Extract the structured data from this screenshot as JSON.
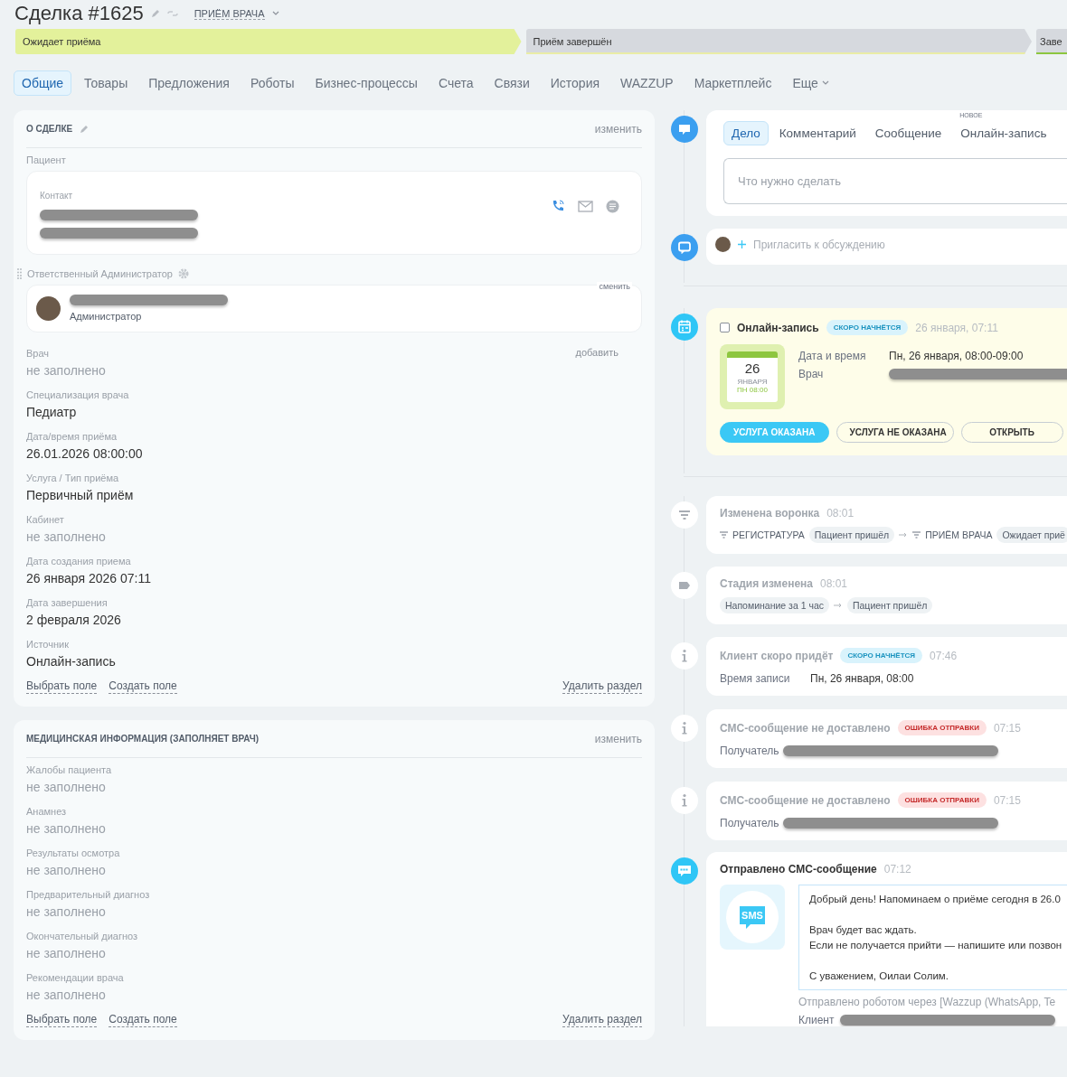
{
  "deal": {
    "title": "Сделка #1625",
    "pipeline": "ПРИЁМ ВРАЧА"
  },
  "stages": [
    {
      "label": "Ожидает приёма",
      "selected": true,
      "color": "#e3f19b"
    },
    {
      "label": "Приём завершён",
      "selected": false,
      "color": "#e9eca6"
    },
    {
      "label": "Заве",
      "selected": false,
      "color": "#8dc63f"
    }
  ],
  "tabs": [
    {
      "label": "Общие",
      "selected": true,
      "kind": "tab"
    },
    {
      "label": "Товары",
      "selected": false,
      "kind": "tab"
    },
    {
      "label": "Предложения",
      "selected": false,
      "kind": "tab"
    },
    {
      "label": "Роботы",
      "selected": false,
      "kind": "tab"
    },
    {
      "label": "Бизнес-процессы",
      "selected": false,
      "kind": "tab"
    },
    {
      "label": "Счета",
      "selected": false,
      "kind": "tab"
    },
    {
      "label": "Связи",
      "selected": false,
      "kind": "tab"
    },
    {
      "label": "История",
      "selected": false,
      "kind": "tab"
    },
    {
      "label": "WAZZUP",
      "selected": false,
      "kind": "tab"
    },
    {
      "label": "Маркетплейс",
      "selected": false,
      "kind": "tab"
    },
    {
      "label": "Еще",
      "selected": false,
      "kind": "more"
    }
  ],
  "sections": [
    {
      "title": "О СДЕЛКЕ",
      "renamable": true,
      "action": "изменить",
      "fields": [
        {
          "kind": "contact",
          "label": "Пациент",
          "sublabel": "Контакт"
        },
        {
          "kind": "user",
          "label": "Ответственный Администратор",
          "action": "сменить",
          "role": "Администратор"
        },
        {
          "kind": "text",
          "label": "Врач",
          "value": "не заполнено",
          "empty": true,
          "action": "добавить"
        },
        {
          "kind": "text",
          "label": "Специализация врача",
          "value": "Педиатр",
          "empty": false
        },
        {
          "kind": "text",
          "label": "Дата/время приёма",
          "value": "26.01.2026 08:00:00",
          "empty": false
        },
        {
          "kind": "text",
          "label": "Услуга / Тип приёма",
          "value": "Первичный приём",
          "empty": false
        },
        {
          "kind": "text",
          "label": "Кабинет",
          "value": "не заполнено",
          "empty": true
        },
        {
          "kind": "text",
          "label": "Дата создания приема",
          "value": "26 января 2026 07:11",
          "empty": false
        },
        {
          "kind": "text",
          "label": "Дата завершения",
          "value": "2 февраля 2026",
          "empty": false
        },
        {
          "kind": "text",
          "label": "Источник",
          "value": "Онлайн-запись",
          "empty": false
        }
      ],
      "links": [
        "Выбрать поле",
        "Создать поле"
      ],
      "delete_label": "Удалить раздел"
    },
    {
      "title": "МЕДИЦИНСКАЯ ИНФОРМАЦИЯ (ЗАПОЛНЯЕТ ВРАЧ)",
      "renamable": false,
      "action": "изменить",
      "fields": [
        {
          "kind": "text",
          "label": "Жалобы пациента",
          "value": "не заполнено",
          "empty": true
        },
        {
          "kind": "text",
          "label": "Анамнез",
          "value": "не заполнено",
          "empty": true
        },
        {
          "kind": "text",
          "label": "Результаты осмотра",
          "value": "не заполнено",
          "empty": true
        },
        {
          "kind": "text",
          "label": "Предварительный диагноз",
          "value": "не заполнено",
          "empty": true
        },
        {
          "kind": "text",
          "label": "Окончательный диагноз",
          "value": "не заполнено",
          "empty": true
        },
        {
          "kind": "text",
          "label": "Рекомендации врача",
          "value": "не заполнено",
          "empty": true
        }
      ],
      "links": [
        "Выбрать поле",
        "Создать поле"
      ],
      "delete_label": "Удалить раздел"
    }
  ],
  "timeline": [
    {
      "kind": "editor",
      "tabs": [
        {
          "label": "Дело",
          "selected": true
        },
        {
          "label": "Комментарий",
          "selected": false
        },
        {
          "label": "Сообщение",
          "selected": false
        },
        {
          "label": "Онлайн-запись",
          "selected": false,
          "badge": "НОВОЕ"
        }
      ],
      "placeholder": "Что нужно сделать"
    },
    {
      "kind": "invite",
      "placeholder": "Пригласить к обсуждению"
    },
    {
      "kind": "booking",
      "checked": false,
      "title": "Онлайн-запись",
      "status": {
        "label": "СКОРО НАЧНЁТСЯ",
        "kind": "info"
      },
      "time": "26 января, 07:11",
      "calendar": {
        "day": "26",
        "month": "ЯНВАРЯ",
        "weekday": "ПН 08:00"
      },
      "rows": [
        {
          "label": "Дата и время",
          "value": "Пн, 26 января, 08:00-09:00",
          "redacted": false
        },
        {
          "label": "Врач",
          "redacted": true
        }
      ],
      "buttons": [
        {
          "label": "УСЛУГА ОКАЗАНА",
          "primary": true
        },
        {
          "label": "УСЛУГА НЕ ОКАЗАНА",
          "primary": false
        },
        {
          "label": "ОТКРЫТЬ",
          "primary": false
        }
      ]
    },
    {
      "kind": "funnel",
      "title": "Изменена воронка",
      "time": "08:01",
      "from": {
        "pipeline": "РЕГИСТРАТУРА",
        "stage": "Пациент пришёл"
      },
      "to": {
        "pipeline": "ПРИЁМ ВРАЧА",
        "stage": "Ожидает приё"
      }
    },
    {
      "kind": "stage",
      "title": "Стадия изменена",
      "time": "08:01",
      "from": "Напоминание за 1 час",
      "to": "Пациент пришёл"
    },
    {
      "kind": "info",
      "title": "Клиент скоро придёт",
      "status": {
        "label": "СКОРО НАЧНЁТСЯ",
        "kind": "info"
      },
      "time": "07:46",
      "rows": [
        {
          "label": "Время записи",
          "value": "Пн, 26 января, 08:00",
          "redacted": false
        }
      ]
    },
    {
      "kind": "info",
      "title": "СМС-сообщение не доставлено",
      "status": {
        "label": "ОШИБКА ОТПРАВКИ",
        "kind": "error"
      },
      "time": "07:15",
      "rows": [
        {
          "label": "Получатель",
          "redacted": true
        }
      ]
    },
    {
      "kind": "info",
      "title": "СМС-сообщение не доставлено",
      "status": {
        "label": "ОШИБКА ОТПРАВКИ",
        "kind": "error"
      },
      "time": "07:15",
      "rows": [
        {
          "label": "Получатель",
          "redacted": true
        }
      ]
    },
    {
      "kind": "sms",
      "title": "Отправлено СМС-сообщение",
      "time": "07:12",
      "badge_text": "SMS",
      "message": [
        "Добрый день! Напоминаем о приёме сегодня в 26.0",
        "Врач будет вас ждать.\nЕсли не получается прийти — напишите или позвон",
        "С уважением, Оилаи Солим."
      ],
      "note": "Отправлено роботом через [Wazzup (WhatsApp, Te",
      "rows": [
        {
          "label": "Клиент",
          "redacted": true
        }
      ]
    }
  ]
}
